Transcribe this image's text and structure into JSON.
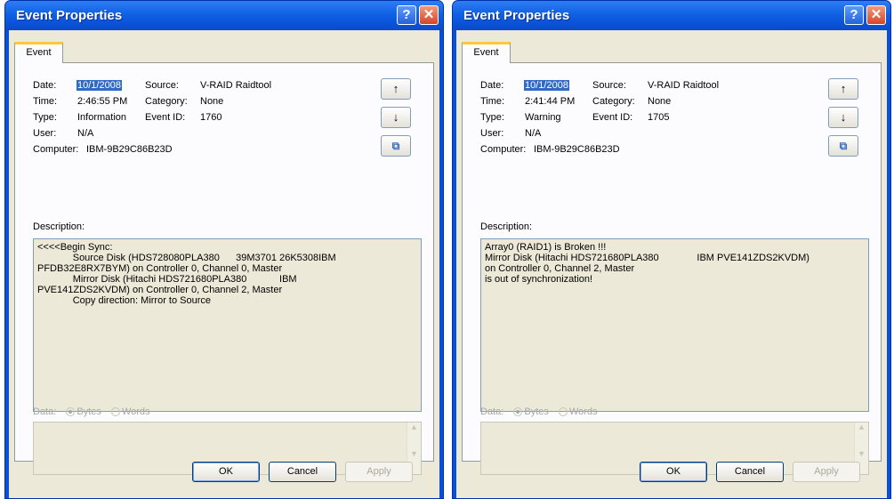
{
  "colors": {
    "titlebar": "#0a55db",
    "dialog_bg": "#ece9d8",
    "selection": "#316ac5",
    "active_tab_accent": "#ffc83c"
  },
  "dialogs": [
    {
      "title": "Event Properties",
      "help_glyph": "?",
      "close_glyph": "✕",
      "tab": "Event",
      "labels": {
        "date": "Date:",
        "time": "Time:",
        "type": "Type:",
        "user": "User:",
        "computer": "Computer:",
        "source": "Source:",
        "category": "Category:",
        "event_id": "Event ID:",
        "description": "Description:",
        "data": "Data:",
        "bytes": "Bytes",
        "words": "Words"
      },
      "date": "10/1/2008",
      "time": "2:46:55 PM",
      "type": "Information",
      "user": "N/A",
      "computer": "IBM-9B29C86B23D",
      "source": "V-RAID Raidtool",
      "category": "None",
      "event_id": "1760",
      "description": "<<<<Begin Sync:\n             Source Disk (HDS728080PLA380      39M3701 26K5308IBM\nPFDB32E8RX7BYM) on Controller 0, Channel 0, Master\n             Mirror Disk (Hitachi HDS721680PLA380            IBM\nPVE141ZDS2KVDM) on Controller 0, Channel 2, Master\n             Copy direction: Mirror to Source",
      "icons": {
        "up": "arrow-up-icon",
        "down": "arrow-down-icon",
        "copy": "copy-icon"
      },
      "buttons": {
        "ok": "OK",
        "cancel": "Cancel",
        "apply": "Apply"
      }
    },
    {
      "title": "Event Properties",
      "help_glyph": "?",
      "close_glyph": "✕",
      "tab": "Event",
      "labels": {
        "date": "Date:",
        "time": "Time:",
        "type": "Type:",
        "user": "User:",
        "computer": "Computer:",
        "source": "Source:",
        "category": "Category:",
        "event_id": "Event ID:",
        "description": "Description:",
        "data": "Data:",
        "bytes": "Bytes",
        "words": "Words"
      },
      "date": "10/1/2008",
      "time": "2:41:44 PM",
      "type": "Warning",
      "user": "N/A",
      "computer": "IBM-9B29C86B23D",
      "source": "V-RAID Raidtool",
      "category": "None",
      "event_id": "1705",
      "description": "Array0 (RAID1) is Broken !!!\nMirror Disk (Hitachi HDS721680PLA380              IBM PVE141ZDS2KVDM)\non Controller 0, Channel 2, Master\nis out of synchronization!",
      "icons": {
        "up": "arrow-up-icon",
        "down": "arrow-down-icon",
        "copy": "copy-icon"
      },
      "buttons": {
        "ok": "OK",
        "cancel": "Cancel",
        "apply": "Apply"
      }
    }
  ]
}
